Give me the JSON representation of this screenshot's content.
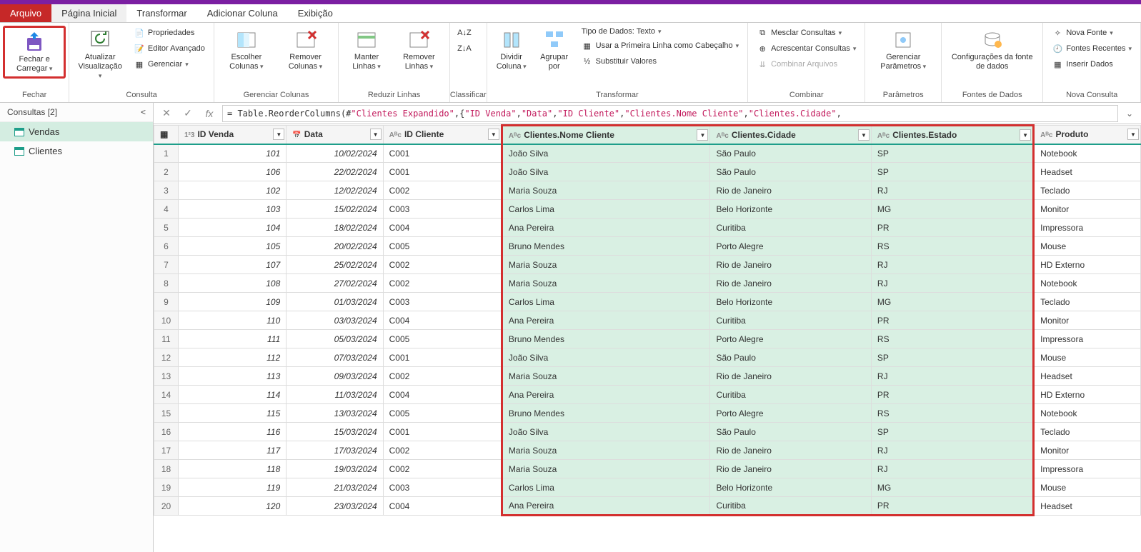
{
  "tabs": {
    "file": "Arquivo",
    "home": "Página Inicial",
    "transform": "Transformar",
    "addcol": "Adicionar Coluna",
    "view": "Exibição"
  },
  "ribbon": {
    "close": {
      "label": "Fechar e\nCarregar",
      "group": "Fechar"
    },
    "refresh": {
      "label": "Atualizar\nVisualização",
      "props": "Propriedades",
      "adv": "Editor Avançado",
      "manage": "Gerenciar",
      "group": "Consulta"
    },
    "cols": {
      "choose": "Escolher\nColunas",
      "remove": "Remover\nColunas",
      "group": "Gerenciar Colunas"
    },
    "rows": {
      "keep": "Manter\nLinhas",
      "remove": "Remover\nLinhas",
      "group": "Reduzir Linhas"
    },
    "sort": {
      "group": "Classificar"
    },
    "split": {
      "label": "Dividir\nColuna"
    },
    "group": {
      "label": "Agrupar\npor"
    },
    "trans": {
      "datatype": "Tipo de Dados: Texto",
      "firstrow": "Usar a Primeira Linha como Cabeçalho",
      "replace": "Substituir Valores",
      "group": "Transformar"
    },
    "combine": {
      "merge": "Mesclar Consultas",
      "append": "Acrescentar Consultas",
      "files": "Combinar Arquivos",
      "group": "Combinar"
    },
    "params": {
      "label": "Gerenciar\nParâmetros",
      "group": "Parâmetros"
    },
    "ds": {
      "label": "Configurações da\nfonte de dados",
      "group": "Fontes de Dados"
    },
    "newq": {
      "new": "Nova Fonte",
      "recent": "Fontes Recentes",
      "enter": "Inserir Dados",
      "group": "Nova Consulta"
    }
  },
  "queries": {
    "header": "Consultas [2]",
    "items": [
      {
        "label": "Vendas"
      },
      {
        "label": "Clientes"
      }
    ]
  },
  "formula": {
    "prefix": "= Table.ReorderColumns(#",
    "p1": "\"Clientes Expandido\"",
    "mid": ",{",
    "p2": "\"ID Venda\"",
    "p3": "\"Data\"",
    "p4": "\"ID Cliente\"",
    "p5": "\"Clientes.Nome Cliente\"",
    "p6": "\"Clientes.Cidade\"",
    "sep": ", "
  },
  "columns": [
    {
      "name": "ID Venda",
      "type": "123",
      "align": "num"
    },
    {
      "name": "Data",
      "type": "cal",
      "align": "num"
    },
    {
      "name": "ID Cliente",
      "type": "ABC",
      "hl": false
    },
    {
      "name": "Clientes.Nome Cliente",
      "type": "ABC",
      "hl": true
    },
    {
      "name": "Clientes.Cidade",
      "type": "ABC",
      "hl": true
    },
    {
      "name": "Clientes.Estado",
      "type": "ABC",
      "hl": true
    },
    {
      "name": "Produto",
      "type": "ABC",
      "hl": false
    }
  ],
  "rows": [
    [
      "101",
      "10/02/2024",
      "C001",
      "João Silva",
      "São Paulo",
      "SP",
      "Notebook"
    ],
    [
      "106",
      "22/02/2024",
      "C001",
      "João Silva",
      "São Paulo",
      "SP",
      "Headset"
    ],
    [
      "102",
      "12/02/2024",
      "C002",
      "Maria Souza",
      "Rio de Janeiro",
      "RJ",
      "Teclado"
    ],
    [
      "103",
      "15/02/2024",
      "C003",
      "Carlos Lima",
      "Belo Horizonte",
      "MG",
      "Monitor"
    ],
    [
      "104",
      "18/02/2024",
      "C004",
      "Ana Pereira",
      "Curitiba",
      "PR",
      "Impressora"
    ],
    [
      "105",
      "20/02/2024",
      "C005",
      "Bruno Mendes",
      "Porto Alegre",
      "RS",
      "Mouse"
    ],
    [
      "107",
      "25/02/2024",
      "C002",
      "Maria Souza",
      "Rio de Janeiro",
      "RJ",
      "HD Externo"
    ],
    [
      "108",
      "27/02/2024",
      "C002",
      "Maria Souza",
      "Rio de Janeiro",
      "RJ",
      "Notebook"
    ],
    [
      "109",
      "01/03/2024",
      "C003",
      "Carlos Lima",
      "Belo Horizonte",
      "MG",
      "Teclado"
    ],
    [
      "110",
      "03/03/2024",
      "C004",
      "Ana Pereira",
      "Curitiba",
      "PR",
      "Monitor"
    ],
    [
      "111",
      "05/03/2024",
      "C005",
      "Bruno Mendes",
      "Porto Alegre",
      "RS",
      "Impressora"
    ],
    [
      "112",
      "07/03/2024",
      "C001",
      "João Silva",
      "São Paulo",
      "SP",
      "Mouse"
    ],
    [
      "113",
      "09/03/2024",
      "C002",
      "Maria Souza",
      "Rio de Janeiro",
      "RJ",
      "Headset"
    ],
    [
      "114",
      "11/03/2024",
      "C004",
      "Ana Pereira",
      "Curitiba",
      "PR",
      "HD Externo"
    ],
    [
      "115",
      "13/03/2024",
      "C005",
      "Bruno Mendes",
      "Porto Alegre",
      "RS",
      "Notebook"
    ],
    [
      "116",
      "15/03/2024",
      "C001",
      "João Silva",
      "São Paulo",
      "SP",
      "Teclado"
    ],
    [
      "117",
      "17/03/2024",
      "C002",
      "Maria Souza",
      "Rio de Janeiro",
      "RJ",
      "Monitor"
    ],
    [
      "118",
      "19/03/2024",
      "C002",
      "Maria Souza",
      "Rio de Janeiro",
      "RJ",
      "Impressora"
    ],
    [
      "119",
      "21/03/2024",
      "C003",
      "Carlos Lima",
      "Belo Horizonte",
      "MG",
      "Mouse"
    ],
    [
      "120",
      "23/03/2024",
      "C004",
      "Ana Pereira",
      "Curitiba",
      "PR",
      "Headset"
    ]
  ]
}
